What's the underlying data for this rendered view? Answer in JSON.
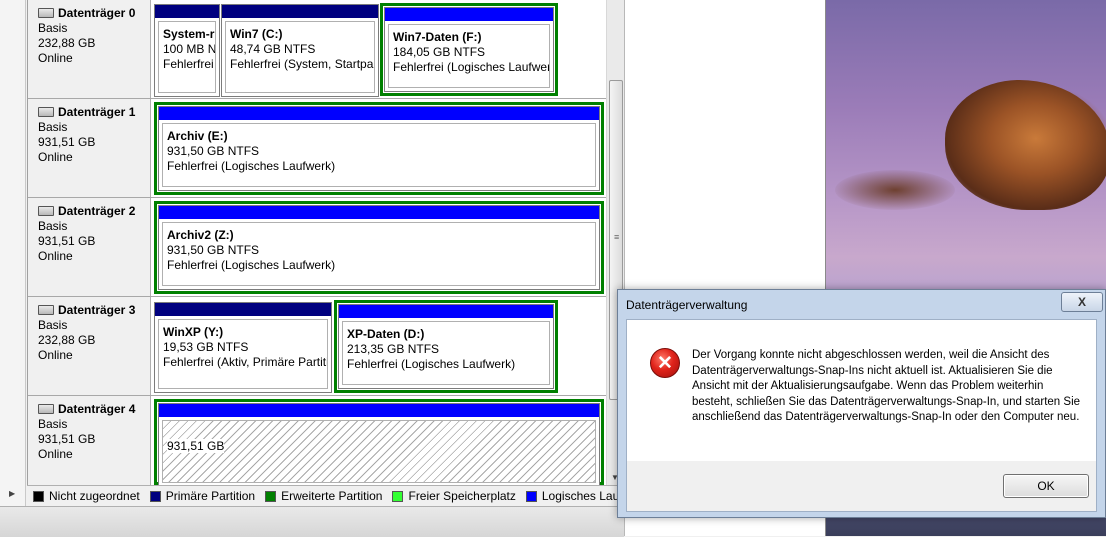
{
  "disks": [
    {
      "name": "Datenträger 0",
      "type": "Basis",
      "size": "232,88 GB",
      "status": "Online"
    },
    {
      "name": "Datenträger 1",
      "type": "Basis",
      "size": "931,51 GB",
      "status": "Online"
    },
    {
      "name": "Datenträger 2",
      "type": "Basis",
      "size": "931,51 GB",
      "status": "Online"
    },
    {
      "name": "Datenträger 3",
      "type": "Basis",
      "size": "232,88 GB",
      "status": "Online"
    },
    {
      "name": "Datenträger 4",
      "type": "Basis",
      "size": "931,51 GB",
      "status": "Online"
    }
  ],
  "partitions": {
    "d0_p0": {
      "name": "System-r",
      "size": "100 MB N",
      "status": "Fehlerfrei"
    },
    "d0_p1": {
      "name": "Win7  (C:)",
      "size": "48,74 GB NTFS",
      "status": "Fehlerfrei (System, Startpar"
    },
    "d0_p2": {
      "name": "Win7-Daten  (F:)",
      "size": "184,05 GB NTFS",
      "status": "Fehlerfrei (Logisches Laufwerk"
    },
    "d1_p0": {
      "name": "Archiv  (E:)",
      "size": "931,50 GB NTFS",
      "status": "Fehlerfrei (Logisches Laufwerk)"
    },
    "d2_p0": {
      "name": "Archiv2  (Z:)",
      "size": "931,50 GB NTFS",
      "status": "Fehlerfrei (Logisches Laufwerk)"
    },
    "d3_p0": {
      "name": "WinXP  (Y:)",
      "size": "19,53 GB NTFS",
      "status": "Fehlerfrei (Aktiv, Primäre Partiti"
    },
    "d3_p1": {
      "name": "XP-Daten  (D:)",
      "size": "213,35 GB NTFS",
      "status": "Fehlerfrei (Logisches Laufwerk)"
    },
    "d4_p0": {
      "size": "931,51 GB"
    }
  },
  "legend": [
    {
      "label": "Nicht zugeordnet",
      "color": "#000000"
    },
    {
      "label": "Primäre Partition",
      "color": "#00007f"
    },
    {
      "label": "Erweiterte Partition",
      "color": "#008000"
    },
    {
      "label": "Freier Speicherplatz",
      "color": "#33ff33"
    },
    {
      "label": "Logisches Laufwerk",
      "color": "#0000ff"
    }
  ],
  "dialog": {
    "title": "Datenträgerverwaltung",
    "close_label": "X",
    "message": "Der Vorgang konnte nicht abgeschlossen werden, weil die Ansicht des Datenträgerverwaltungs-Snap-Ins nicht aktuell ist. Aktualisieren Sie die Ansicht mit der Aktualisierungsaufgabe. Wenn das Problem weiterhin besteht, schließen Sie das Datenträgerverwaltungs-Snap-In, und starten Sie anschließend das Datenträgerverwaltungs-Snap-In oder den Computer neu.",
    "ok_label": "OK",
    "icon": "error-icon"
  }
}
